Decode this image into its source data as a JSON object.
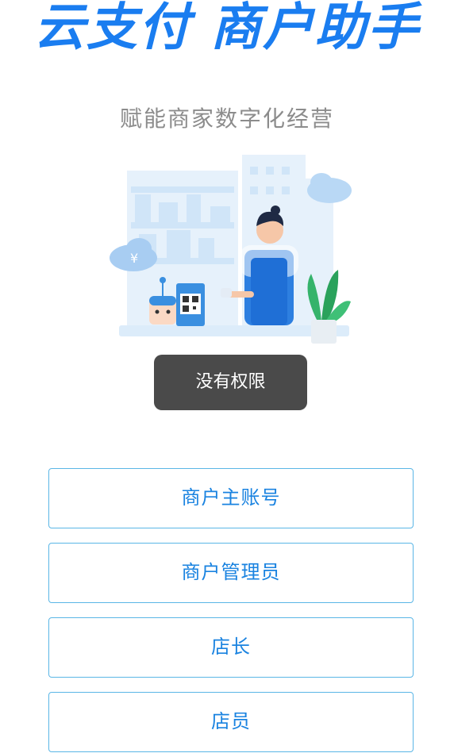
{
  "brand": {
    "title": "云支付 商户助手",
    "color": "#1a7df0"
  },
  "tagline": "赋能商家数字化经营",
  "illustration": {
    "cloud_left_symbol": "¥",
    "icons": [
      "cloud-icon",
      "building-skyline",
      "merchant-figure",
      "plant-icon",
      "qr-stand-icon",
      "robot-icon"
    ]
  },
  "toast": {
    "message": "没有权限"
  },
  "roles": {
    "items": [
      {
        "label": "商户主账号"
      },
      {
        "label": "商户管理员"
      },
      {
        "label": "店长"
      },
      {
        "label": "店员"
      }
    ],
    "accent_color": "#1a83e0",
    "border_color": "#5ab6e6"
  }
}
